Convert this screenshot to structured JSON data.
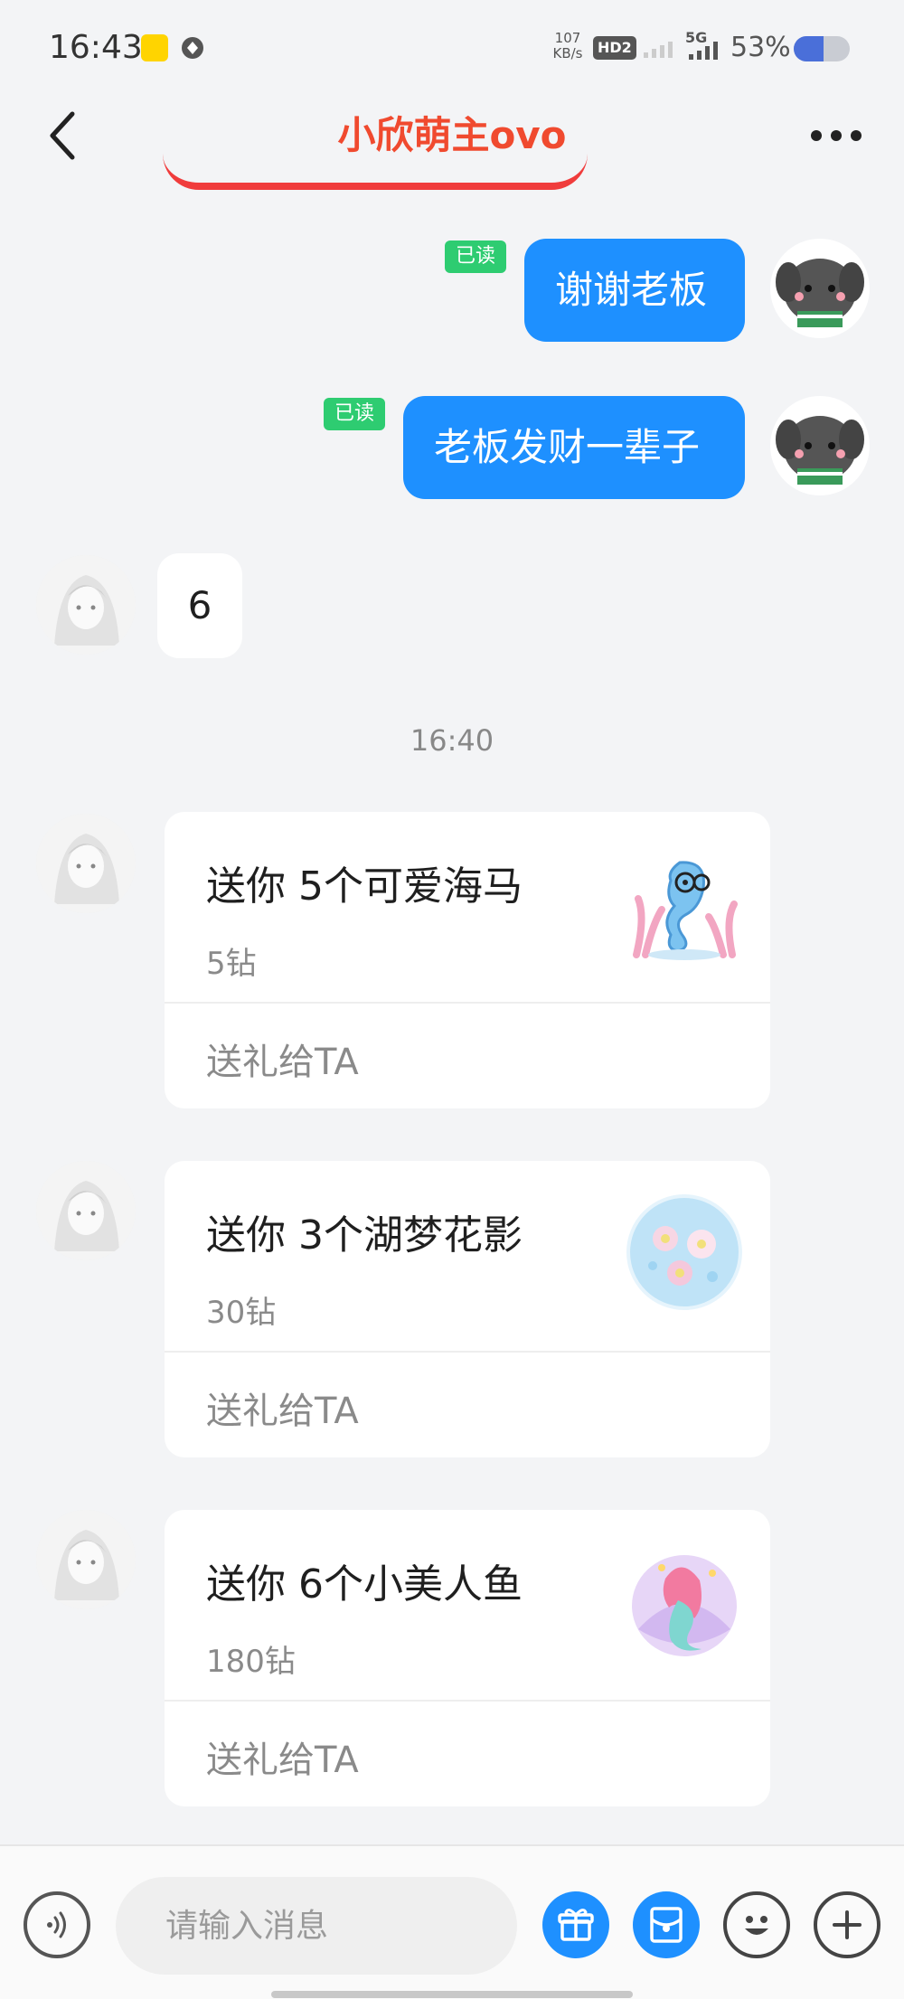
{
  "status_bar": {
    "time": "16:43",
    "net_speed_value": "107",
    "net_speed_unit": "KB/s",
    "hd_label": "HD2",
    "network_label": "5G",
    "battery_percent": "53%",
    "battery_level": 0.53
  },
  "header": {
    "title": "小欣萌主ovo"
  },
  "messages": {
    "outgoing": [
      {
        "text": "谢谢老板",
        "read_label": "已读"
      },
      {
        "text": "老板发财一辈子",
        "read_label": "已读"
      }
    ],
    "incoming_text": "6",
    "timestamp": "16:40"
  },
  "gifts": [
    {
      "title": "送你 5个可爱海马",
      "price": "5钻",
      "action": "送礼给TA",
      "icon": "seahorse-gift-icon"
    },
    {
      "title": "送你 3个湖梦花影",
      "price": "30钻",
      "action": "送礼给TA",
      "icon": "lake-dream-flower-gift-icon"
    },
    {
      "title": "送你 6个小美人鱼",
      "price": "180钻",
      "action": "送礼给TA",
      "icon": "mermaid-gift-icon"
    }
  ],
  "input_bar": {
    "placeholder": "请输入消息"
  },
  "colors": {
    "title": "#f04a2f",
    "bubble_out": "#1e90ff",
    "read_badge": "#2ecc71",
    "background": "#f3f4f6"
  }
}
